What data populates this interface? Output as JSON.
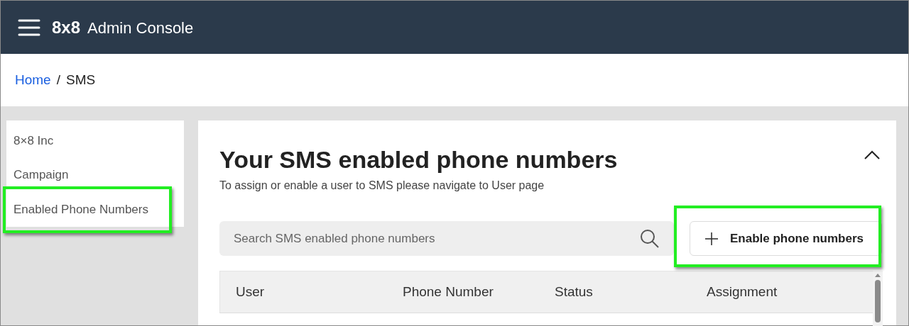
{
  "header": {
    "logo": "8x8",
    "title": "Admin Console"
  },
  "breadcrumb": [
    {
      "label": "Home",
      "kind": "link"
    },
    {
      "label": "SMS",
      "kind": "current"
    }
  ],
  "breadcrumb_separator": "/",
  "sidebar": {
    "items": [
      {
        "label": "8×8 Inc",
        "highlighted": false
      },
      {
        "label": "Campaign",
        "highlighted": false
      },
      {
        "label": "Enabled Phone Numbers",
        "highlighted": true
      }
    ]
  },
  "panel": {
    "title": "Your SMS enabled phone numbers",
    "subtitle": "To assign or enable a user to SMS please navigate to User page",
    "expanded": true,
    "search": {
      "placeholder": "Search SMS enabled phone numbers"
    },
    "button": {
      "label": "Enable phone numbers",
      "highlighted": true
    },
    "table": {
      "columns": [
        "User",
        "Phone Number",
        "Status",
        "Assignment"
      ]
    }
  }
}
